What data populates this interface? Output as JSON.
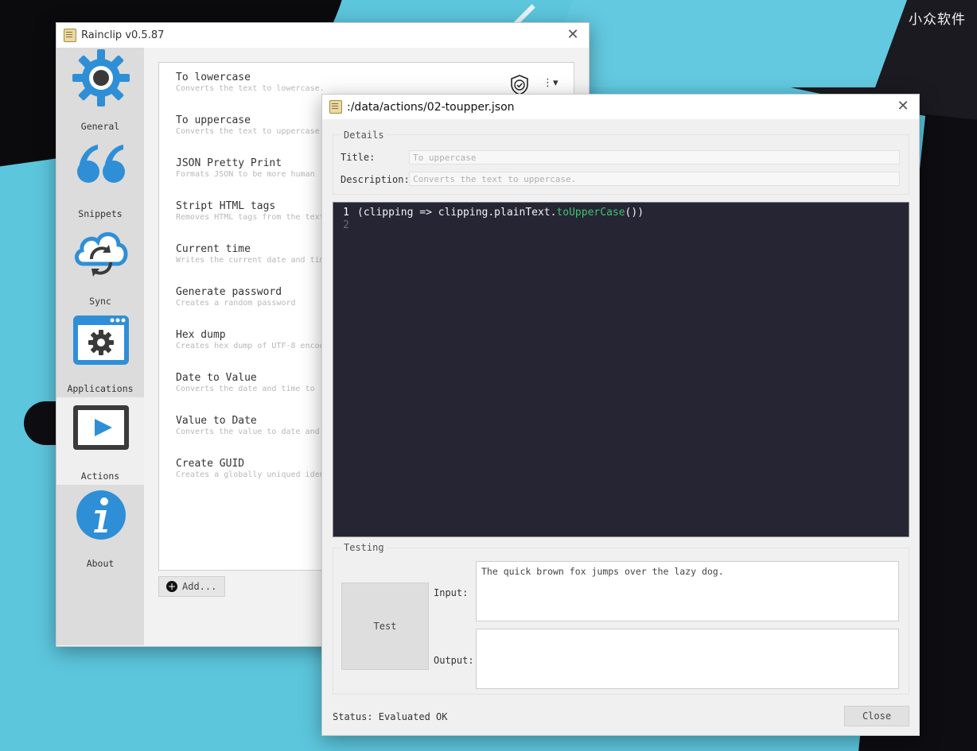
{
  "watermark": "小众软件",
  "main_window": {
    "title": "Rainclip v0.5.87",
    "sidebar": [
      {
        "label": "General",
        "icon": "gear-icon"
      },
      {
        "label": "Snippets",
        "icon": "quote-icon"
      },
      {
        "label": "Sync",
        "icon": "cloud-sync-icon"
      },
      {
        "label": "Applications",
        "icon": "app-settings-icon"
      },
      {
        "label": "Actions",
        "icon": "play-icon",
        "active": true
      },
      {
        "label": "About",
        "icon": "info-icon"
      }
    ],
    "actions": [
      {
        "title": "To lowercase",
        "desc": "Converts the text to lowercase."
      },
      {
        "title": "To uppercase",
        "desc": "Converts the text to uppercase."
      },
      {
        "title": "JSON Pretty Print",
        "desc": "Formats JSON to be more human"
      },
      {
        "title": "Stript HTML tags",
        "desc": "Removes HTML tags from the text"
      },
      {
        "title": "Current time",
        "desc": "Writes the current date and time"
      },
      {
        "title": "Generate password",
        "desc": "Creates a random password"
      },
      {
        "title": "Hex dump",
        "desc": "Creates hex dump of UTF-8 encoded"
      },
      {
        "title": "Date to Value",
        "desc": "Converts the date and time to"
      },
      {
        "title": "Value to Date",
        "desc": "Converts the value to date and"
      },
      {
        "title": "Create GUID",
        "desc": "Creates a globally uniqued identifier"
      }
    ],
    "add_label": "Add..."
  },
  "dialog": {
    "title": ":/data/actions/02-toupper.json",
    "details_label": "Details",
    "title_label": "Title:",
    "title_value": "To uppercase",
    "description_label": "Description:",
    "description_value": "Converts the text to uppercase.",
    "code": {
      "line1_num": "1",
      "line1_pre": "(clipping => clipping.plainText.",
      "line1_method": "toUpperCase",
      "line1_post": "())",
      "line2_num": "2"
    },
    "testing_label": "Testing",
    "test_button": "Test",
    "input_label": "Input:",
    "input_value": "The quick brown fox jumps over the lazy dog.",
    "output_label": "Output:",
    "output_value": "",
    "status": "Status: Evaluated OK",
    "close_button": "Close"
  },
  "colors": {
    "accent_blue": "#2f8fd6",
    "code_bg": "#262534",
    "code_method": "#3ec46d"
  }
}
